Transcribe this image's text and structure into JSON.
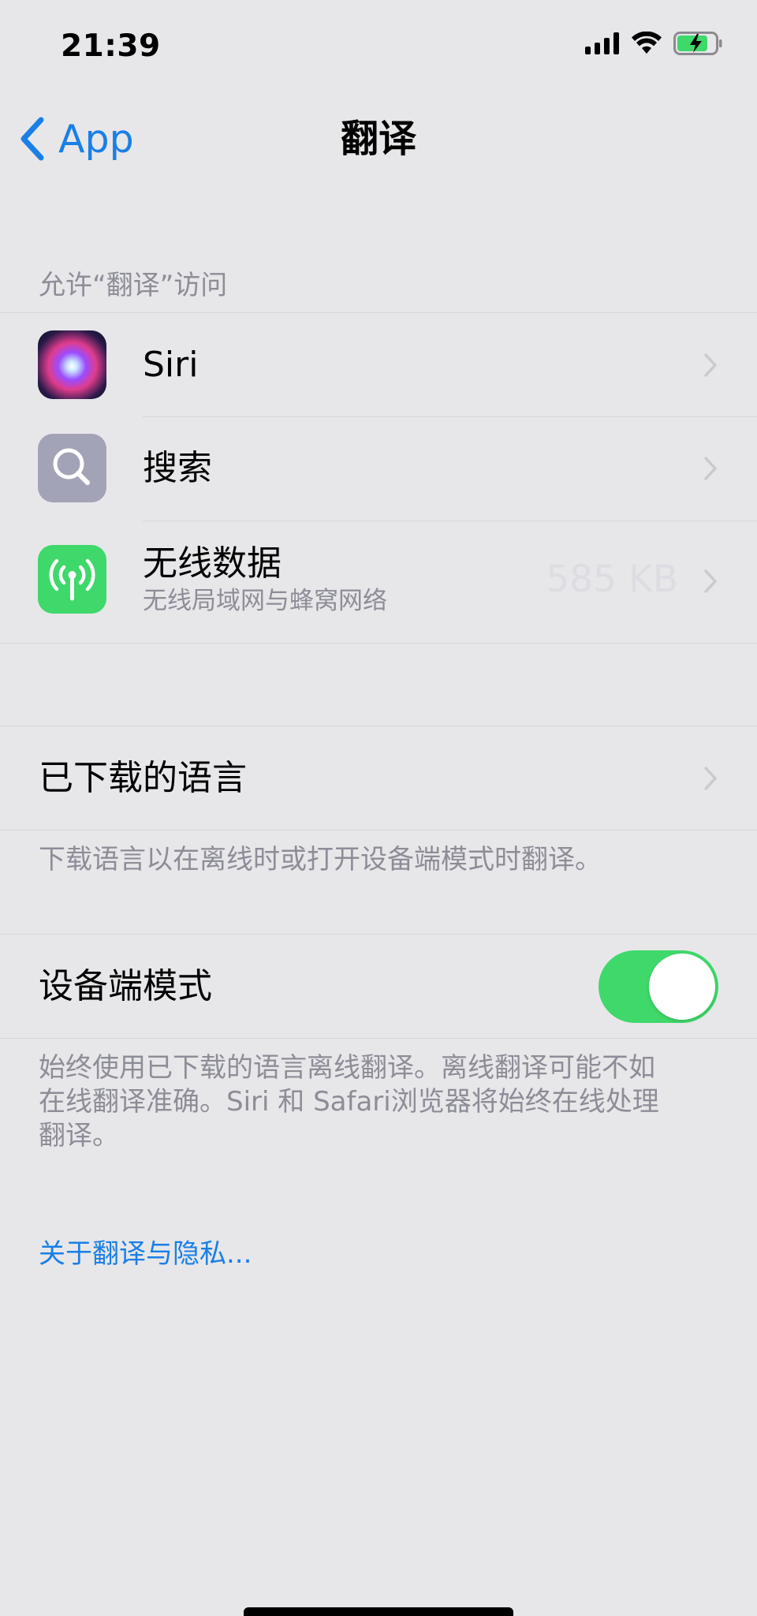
{
  "status_bar": {
    "time": "21:39"
  },
  "nav": {
    "back_label": "App",
    "title": "翻译"
  },
  "access_section": {
    "header": "允许“翻译”访问",
    "items": [
      {
        "label": "Siri",
        "icon": "siri-icon"
      },
      {
        "label": "搜索",
        "icon": "search-icon"
      },
      {
        "label": "无线数据",
        "subtitle": "无线局域网与蜂窝网络",
        "value": "585 KB",
        "icon": "antenna-icon"
      }
    ]
  },
  "languages_section": {
    "label": "已下载的语言",
    "footer": "下载语言以在离线时或打开设备端模式时翻译。"
  },
  "device_mode_section": {
    "label": "设备端模式",
    "toggle_on": true,
    "footer": "始终使用已下载的语言离线翻译。离线翻译可能不如在线翻译准确。Siri 和 Safari浏览器将始终在线处理翻译。"
  },
  "privacy_link": "关于翻译与隐私...",
  "colors": {
    "accent": "#1a7fe6",
    "toggle_on": "#3fd86a",
    "background": "#e7e7ea"
  }
}
